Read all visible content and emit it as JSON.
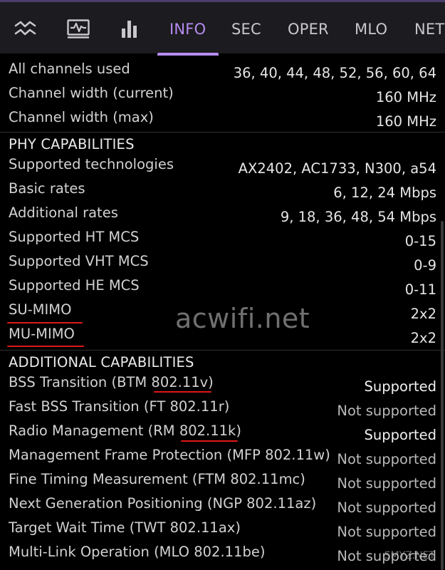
{
  "tabs": [
    {
      "type": "icon",
      "icon": "signal-graph-icon"
    },
    {
      "type": "icon",
      "icon": "waveform-icon"
    },
    {
      "type": "icon",
      "icon": "bar-chart-icon"
    },
    {
      "type": "text",
      "label": "INFO",
      "active": true
    },
    {
      "type": "text",
      "label": "SEC",
      "active": false
    },
    {
      "type": "text",
      "label": "OPER",
      "active": false
    },
    {
      "type": "text",
      "label": "MLO",
      "active": false
    },
    {
      "type": "text",
      "label": "NET",
      "active": false
    }
  ],
  "accent_color": "#b58cf0",
  "highlight_color": "#e01818",
  "channel": {
    "rows": [
      {
        "label": "All channels used",
        "value": "36, 40, 44, 48, 52, 56, 60, 64"
      },
      {
        "label": "Channel width (current)",
        "value": "160 MHz"
      },
      {
        "label": "Channel width (max)",
        "value": "160 MHz"
      }
    ]
  },
  "phy": {
    "title": "PHY CAPABILITIES",
    "rows": [
      {
        "label": "Supported technologies",
        "value": "AX2402, AC1733, N300, a54"
      },
      {
        "label": "Basic rates",
        "value": "6, 12, 24 Mbps"
      },
      {
        "label": "Additional rates",
        "value": "9, 18, 36, 48, 54 Mbps"
      },
      {
        "label": "Supported HT MCS",
        "value": "0-15"
      },
      {
        "label": "Supported VHT MCS",
        "value": "0-9"
      },
      {
        "label": "Supported HE MCS",
        "value": "0-11"
      },
      {
        "label": "SU-MIMO",
        "value": "2x2"
      },
      {
        "label": "MU-MIMO",
        "value": "2x2"
      }
    ]
  },
  "additional": {
    "title": "ADDITIONAL CAPABILITIES",
    "rows": [
      {
        "label": "BSS Transition (BTM 802.11v)",
        "value": "Supported"
      },
      {
        "label": "Fast BSS Transition (FT 802.11r)",
        "value": "Not supported"
      },
      {
        "label": "Radio Management (RM 802.11k)",
        "value": "Supported"
      },
      {
        "label": "Management Frame Protection (MFP 802.11w)",
        "value": "Not supported"
      },
      {
        "label": "Fine Timing Measurement (FTM 802.11mc)",
        "value": "Not supported"
      },
      {
        "label": "Next Generation Positioning (NGP 802.11az)",
        "value": "Not supported"
      },
      {
        "label": "Target Wait Time (TWT 802.11ax)",
        "value": "Not supported"
      },
      {
        "label": "Multi-Link Operation (MLO 802.11be)",
        "value": "Not supported"
      }
    ]
  },
  "watermark": "acwifi.net",
  "watermark_corner": "SMYZ.NET"
}
